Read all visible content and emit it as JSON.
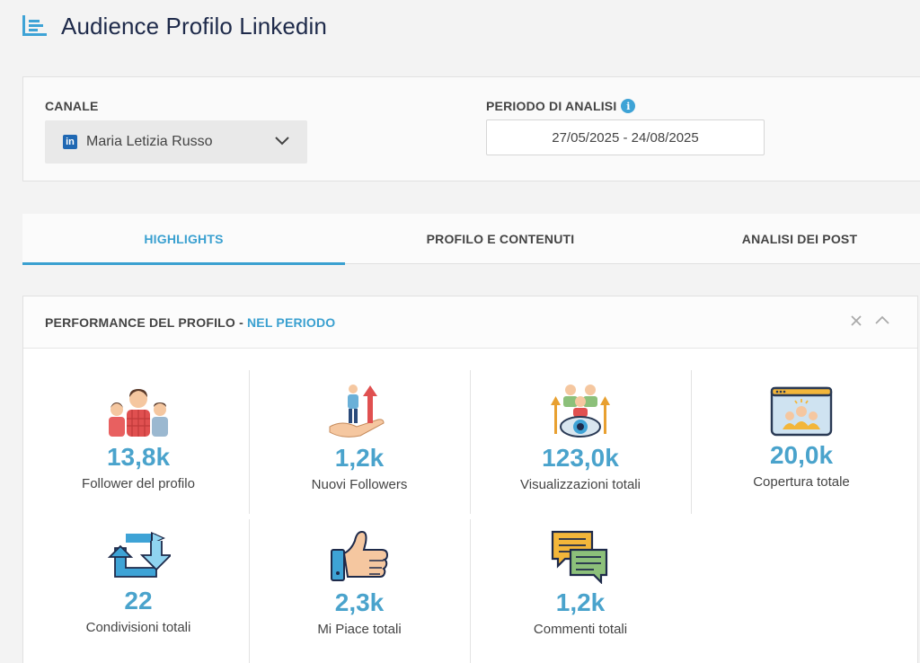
{
  "header": {
    "title": "Audience Profilo Linkedin",
    "icon": "bar-chart-list-icon"
  },
  "filters": {
    "channel_label": "CANALE",
    "channel_value": "Maria Letizia Russo",
    "channel_icon": "linkedin-icon",
    "period_label": "PERIODO DI ANALISI",
    "period_value": "27/05/2025 - 24/08/2025"
  },
  "tabs": [
    {
      "label": "HIGHLIGHTS",
      "active": true
    },
    {
      "label": "PROFILO E CONTENUTI",
      "active": false
    },
    {
      "label": "ANALISI DEI POST",
      "active": false
    }
  ],
  "panel": {
    "title": "PERFORMANCE DEL PROFILO -",
    "subtitle": "NEL PERIODO",
    "kpis": [
      {
        "value": "13,8k",
        "label": "Follower del profilo",
        "icon": "people-group-icon"
      },
      {
        "value": "1,2k",
        "label": "Nuovi Followers",
        "icon": "growth-hand-icon"
      },
      {
        "value": "123,0k",
        "label": "Visualizzazioni totali",
        "icon": "eye-views-icon"
      },
      {
        "value": "20,0k",
        "label": "Copertura totale",
        "icon": "audience-reach-icon"
      },
      {
        "value": "22",
        "label": "Condivisioni totali",
        "icon": "share-arrows-icon"
      },
      {
        "value": "2,3k",
        "label": "Mi Piace totali",
        "icon": "thumbs-up-icon"
      },
      {
        "value": "1,2k",
        "label": "Commenti totali",
        "icon": "comments-icon"
      }
    ]
  },
  "colors": {
    "accent": "#3aa0d0",
    "value": "#4aa3cc",
    "title": "#1e2a4a"
  }
}
